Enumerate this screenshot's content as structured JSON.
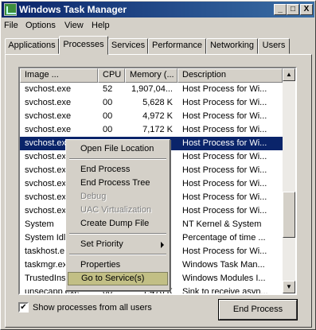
{
  "window": {
    "title": "Windows Task Manager"
  },
  "titlebar_buttons": {
    "minimize": "_",
    "maximize": "□",
    "close": "X"
  },
  "menu": {
    "items": [
      "File",
      "Options",
      "View",
      "Help"
    ]
  },
  "tabs": [
    "Applications",
    "Processes",
    "Services",
    "Performance",
    "Networking",
    "Users"
  ],
  "active_tab": "Processes",
  "columns": [
    "Image ...",
    "CPU",
    "Memory (...",
    "Description"
  ],
  "rows": [
    {
      "image": "svchost.exe",
      "cpu": "52",
      "memory": "1,907,04...",
      "description": "Host Process for Wi..."
    },
    {
      "image": "svchost.exe",
      "cpu": "00",
      "memory": "5,628 K",
      "description": "Host Process for Wi..."
    },
    {
      "image": "svchost.exe",
      "cpu": "00",
      "memory": "4,972 K",
      "description": "Host Process for Wi..."
    },
    {
      "image": "svchost.exe",
      "cpu": "00",
      "memory": "7,172 K",
      "description": "Host Process for Wi..."
    },
    {
      "image": "svchost.exe",
      "cpu": "",
      "memory": "",
      "description": "Host Process for Wi...",
      "selected": true
    },
    {
      "image": "svchost.exe",
      "cpu": "",
      "memory": "",
      "description": "Host Process for Wi..."
    },
    {
      "image": "svchost.exe",
      "cpu": "",
      "memory": "",
      "description": "Host Process for Wi..."
    },
    {
      "image": "svchost.exe",
      "cpu": "",
      "memory": "",
      "description": "Host Process for Wi..."
    },
    {
      "image": "svchost.exe",
      "cpu": "",
      "memory": "",
      "description": "Host Process for Wi..."
    },
    {
      "image": "svchost.exe",
      "cpu": "",
      "memory": "",
      "description": "Host Process for Wi..."
    },
    {
      "image": "System",
      "cpu": "",
      "memory": "",
      "description": "NT Kernel & System"
    },
    {
      "image": "System Idle",
      "cpu": "",
      "memory": "",
      "description": "Percentage of time ..."
    },
    {
      "image": "taskhost.e",
      "cpu": "",
      "memory": "",
      "description": "Host Process for Wi..."
    },
    {
      "image": "taskmgr.ex",
      "cpu": "",
      "memory": "",
      "description": "Windows Task Man..."
    },
    {
      "image": "TrustedIns",
      "cpu": "",
      "memory": "",
      "description": "Windows Modules I..."
    },
    {
      "image": "unsecapp.exe",
      "cpu": "00",
      "memory": "1,476 K",
      "description": "Sink to receive asyn..."
    }
  ],
  "context_menu": [
    {
      "label": "Open File Location"
    },
    {
      "separator": true
    },
    {
      "label": "End Process"
    },
    {
      "label": "End Process Tree"
    },
    {
      "label": "Debug",
      "disabled": true
    },
    {
      "label": "UAC Virtualization",
      "disabled": true
    },
    {
      "label": "Create Dump File"
    },
    {
      "separator": true
    },
    {
      "label": "Set Priority",
      "submenu": true
    },
    {
      "separator": true
    },
    {
      "label": "Properties"
    },
    {
      "label": "Go to Service(s)",
      "highlighted": true
    }
  ],
  "show_all_processes": {
    "label": "Show processes from all users",
    "checked": true,
    "mark": "✔"
  },
  "end_process_button": "End Process",
  "scrollbar": {
    "up": "▲",
    "down": "▼"
  }
}
